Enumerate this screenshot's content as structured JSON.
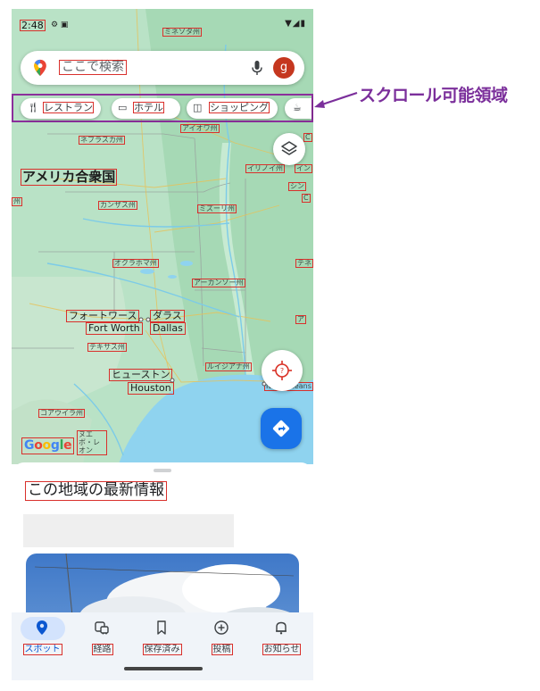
{
  "status_bar": {
    "time": "2:48",
    "left_icons": "⚙ ▣",
    "right_icons": "▼◢▮"
  },
  "search": {
    "placeholder": "ここで検索",
    "avatar_letter": "g"
  },
  "chips": [
    {
      "icon": "fork-knife-icon",
      "label": "レストラン"
    },
    {
      "icon": "bed-icon",
      "label": "ホテル"
    },
    {
      "icon": "shopping-bag-icon",
      "label": "ショッピング"
    },
    {
      "icon": "coffee-cup-icon",
      "label": ""
    }
  ],
  "callout": {
    "text": "スクロール可能領域",
    "color": "#7b2f9b"
  },
  "map": {
    "country": "アメリカ合衆国",
    "state_labels": {
      "minnesota": "ミネソタ州",
      "iowa": "アイオワ州",
      "nebraska": "ネブラスカ州",
      "illinois": "イリノイ州",
      "illinois_edge": "イン",
      "kansas": "カンザス州",
      "missouri": "ミズーリ州",
      "oklahoma": "オクラホマ州",
      "arkansas": "アーカンソー州",
      "texas": "テキサス州",
      "louisiana": "ルイジアナ州",
      "coahuila": "コアウイラ州",
      "nuevo_leon": "ヌエボ・レオン",
      "edge_c1": "C",
      "edge_shin": "シン",
      "edge_c2": "C",
      "edge_te": "テネ",
      "edge_a": "ア",
      "edge_shu": "州",
      "edge_pa": "パ",
      "new_orleans": "New Orleans"
    },
    "cities": {
      "fort_worth_ja": "フォートワース",
      "fort_worth_en": "Fort Worth",
      "dallas_ja": "ダラス",
      "dallas_en": "Dallas",
      "houston_ja": "ヒューストン",
      "houston_en": "Houston"
    },
    "logo": "Google",
    "colors": {
      "land": "#b8e0c3",
      "water": "#8fd3ef",
      "river": "#7ccbe8",
      "accent": "#1a73e8"
    }
  },
  "sheet": {
    "title": "この地域の最新情報"
  },
  "bottom_nav": [
    {
      "label": "スポット",
      "icon": "location-pin-icon",
      "active": true
    },
    {
      "label": "経路",
      "icon": "commute-icon",
      "active": false
    },
    {
      "label": "保存済み",
      "icon": "bookmark-icon",
      "active": false
    },
    {
      "label": "投稿",
      "icon": "add-circle-icon",
      "active": false
    },
    {
      "label": "お知らせ",
      "icon": "bell-icon",
      "active": false
    }
  ]
}
